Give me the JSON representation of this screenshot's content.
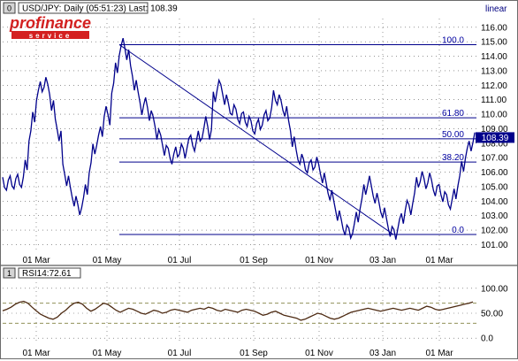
{
  "main_panel": {
    "index_label": "0",
    "title": "USD/JPY: Daily (05:51:23) Last: 108.39",
    "scale_mode": "linear",
    "logo_text": "profinance",
    "logo_subtext": "service",
    "last_price_label": "108.39"
  },
  "rsi_panel": {
    "index_label": "1",
    "title": "RSI14:72.61"
  },
  "colors": {
    "price_line": "#00008b",
    "fib_lines": "#00008b",
    "fib_labels": "#0000a0",
    "rsi_line": "#4d2a12",
    "panel_header": "#ffffff",
    "grid": "#555555",
    "logo_red": "#d42020",
    "logo_blue": "#1a3fa8"
  },
  "chart_data": [
    {
      "type": "line",
      "title": "USD/JPY: Daily (05:51:23) Last: 108.39",
      "x_tick_labels": [
        "01 Mar",
        "01 May",
        "01 Jul",
        "01 Sep",
        "01 Nov",
        "03 Jan",
        "01 Mar"
      ],
      "y_tick_labels": [
        "101.00",
        "102.00",
        "103.00",
        "104.00",
        "105.00",
        "106.00",
        "107.00",
        "108.00",
        "109.00",
        "110.00",
        "111.00",
        "112.00",
        "113.00",
        "114.00",
        "115.00",
        "116.00"
      ],
      "ylim": [
        100.6,
        116.6
      ],
      "last_value": 108.39,
      "series": [
        {
          "values": [
            105.3,
            105.1,
            105.4,
            105.2,
            105.5,
            105.3,
            106.5,
            108.5,
            109.8,
            111.3,
            111.9,
            112.2,
            111.7,
            110.6,
            109.3,
            108.5,
            106.2,
            105.4,
            104.6,
            104.0,
            103.4,
            103.9,
            104.8,
            106.3,
            107.6,
            108.2,
            108.8,
            110.2,
            109.6,
            111.8,
            113.2,
            114.4,
            114.9,
            114.1,
            113.0,
            112.0,
            111.2,
            110.3,
            110.8,
            109.9,
            109.5,
            108.6,
            108.2,
            107.5,
            107.3,
            106.9,
            107.4,
            107.6,
            107.3,
            108.0,
            108.2,
            107.8,
            108.5,
            108.7,
            109.5,
            108.6,
            111.2,
            112.0,
            111.7,
            111.0,
            110.4,
            110.3,
            110.0,
            109.7,
            109.8,
            109.5,
            109.2,
            109.0,
            109.3,
            109.6,
            109.9,
            110.1,
            111.3,
            111.0,
            110.6,
            110.2,
            109.2,
            108.1,
            107.2,
            106.9,
            106.5,
            106.3,
            106.5,
            106.7,
            106.2,
            105.6,
            104.9,
            104.4,
            103.7,
            103.0,
            102.4,
            102.0,
            101.8,
            102.1,
            102.9,
            103.8,
            104.8,
            105.4,
            104.7,
            104.2,
            103.6,
            103.2,
            102.5,
            101.9,
            101.7,
            102.4,
            102.8,
            103.7,
            103.4,
            104.2,
            105.3,
            105.7,
            105.2,
            105.6,
            105.1,
            104.7,
            104.8,
            104.3,
            104.1,
            103.8,
            104.5,
            105.4,
            106.4,
            107.3,
            107.8,
            108.39
          ]
        }
      ],
      "fibonacci_levels": [
        {
          "label": "100.0",
          "value": 114.8
        },
        {
          "label": "61.80",
          "value": 109.75
        },
        {
          "label": "50.00",
          "value": 108.3
        },
        {
          "label": "38.20",
          "value": 106.7
        },
        {
          "label": "0.0",
          "value": 101.7
        }
      ]
    },
    {
      "type": "line",
      "title": "RSI14:72.61",
      "x_tick_labels": [
        "01 Mar",
        "01 May",
        "01 Jul",
        "01 Sep",
        "01 Nov",
        "03 Jan",
        "01 Mar"
      ],
      "y_tick_labels": [
        "100.00",
        "50.00",
        "0.0"
      ],
      "ylim": [
        -12,
        112
      ],
      "reference_lines": [
        70,
        30
      ],
      "last_value": 72.61,
      "series": [
        {
          "values": [
            55,
            58,
            62,
            68,
            72,
            74,
            70,
            62,
            55,
            48,
            44,
            40,
            38,
            42,
            50,
            56,
            64,
            70,
            72,
            68,
            60,
            54,
            58,
            64,
            70,
            68,
            62,
            56,
            52,
            56,
            60,
            58,
            54,
            50,
            48,
            52,
            56,
            54,
            50,
            52,
            56,
            58,
            56,
            54,
            52,
            56,
            58,
            60,
            58,
            62,
            60,
            56,
            54,
            58,
            56,
            54,
            52,
            56,
            58,
            56,
            54,
            50,
            46,
            48,
            52,
            54,
            50,
            46,
            44,
            42,
            40,
            36,
            38,
            42,
            46,
            50,
            48,
            44,
            40,
            38,
            40,
            44,
            48,
            52,
            54,
            56,
            58,
            60,
            58,
            56,
            54,
            56,
            58,
            60,
            58,
            56,
            58,
            60,
            58,
            56,
            60,
            64,
            62,
            58,
            56,
            58,
            60,
            62,
            64,
            66,
            68,
            70,
            72.61
          ]
        }
      ]
    }
  ]
}
